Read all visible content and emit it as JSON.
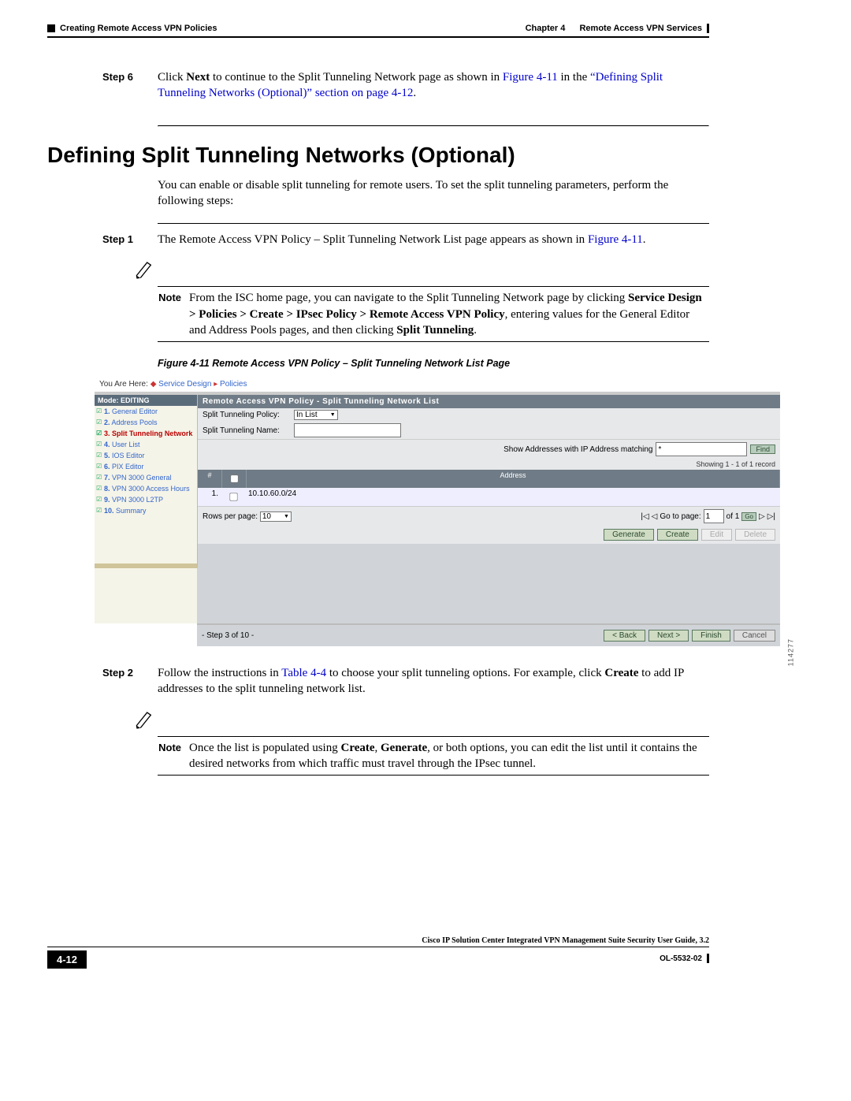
{
  "header": {
    "left": "Creating Remote Access VPN Policies",
    "right_chapter": "Chapter 4",
    "right_title": "Remote Access VPN Services"
  },
  "step6": {
    "label": "Step 6",
    "pre": "Click ",
    "next": "Next",
    "mid": " to continue to the Split Tunneling Network page as shown in ",
    "figref": "Figure 4-11",
    "mid2": " in the ",
    "linkq": "“Defining Split Tunneling Networks (Optional)” section on page 4-12",
    "post": "."
  },
  "section_title": "Defining Split Tunneling Networks (Optional)",
  "intro": "You can enable or disable split tunneling for remote users. To set the split tunneling parameters, perform the following steps:",
  "step1": {
    "label": "Step 1",
    "pre": "The Remote Access VPN Policy – Split Tunneling Network List page appears as shown in ",
    "figref": "Figure 4-11",
    "post": "."
  },
  "note1": {
    "label": "Note",
    "pre": "From the ISC home page, you can navigate to the Split Tunneling Network page by clicking ",
    "b1": "Service Design > Policies > Create > IPsec Policy > Remote Access VPN Policy",
    "mid": ", entering values for the General Editor and Address Pools pages, and then clicking ",
    "b2": "Split Tunneling",
    "post": "."
  },
  "figure_caption": "Figure 4-11   Remote Access VPN Policy – Split Tunneling Network List Page",
  "screenshot": {
    "breadcrumb_prefix": "You Are Here: ",
    "bc1": "Service Design",
    "bc2": "Policies",
    "mode": "Mode: EDITING",
    "sidebar": [
      {
        "n": "1.",
        "t": "General Editor",
        "cur": false
      },
      {
        "n": "2.",
        "t": "Address Pools",
        "cur": false
      },
      {
        "n": "3.",
        "t": "Split Tunneling Network",
        "cur": true
      },
      {
        "n": "4.",
        "t": "User List",
        "cur": false
      },
      {
        "n": "5.",
        "t": "IOS Editor",
        "cur": false
      },
      {
        "n": "6.",
        "t": "PIX Editor",
        "cur": false
      },
      {
        "n": "7.",
        "t": "VPN 3000 General",
        "cur": false
      },
      {
        "n": "8.",
        "t": "VPN 3000 Access Hours",
        "cur": false
      },
      {
        "n": "9.",
        "t": "VPN 3000 L2TP",
        "cur": false
      },
      {
        "n": "10.",
        "t": "Summary",
        "cur": false
      }
    ],
    "pane_title": "Remote Access VPN Policy - Split Tunneling Network List",
    "policy_label": "Split Tunneling Policy:",
    "policy_value": "In List",
    "name_label": "Split Tunneling Name:",
    "find_label": "Show Addresses with IP Address matching",
    "find_value": "*",
    "find_btn": "Find",
    "showing": "Showing 1 - 1 of 1 record",
    "col_num": "#",
    "col_addr": "Address",
    "row_num": "1.",
    "row_addr": "10.10.60.0/24",
    "rpp_label": "Rows per page:",
    "rpp_value": "10",
    "goto_label": "Go to page:",
    "goto_value": "1",
    "of_label": "of 1",
    "go_btn": "Go",
    "btn_generate": "Generate",
    "btn_create": "Create",
    "btn_edit": "Edit",
    "btn_delete": "Delete",
    "step_indicator": "- Step 3 of 10 -",
    "btn_back": "< Back",
    "btn_next": "Next >",
    "btn_finish": "Finish",
    "btn_cancel": "Cancel",
    "side_number": "114277"
  },
  "step2": {
    "label": "Step 2",
    "pre": "Follow the instructions in ",
    "tableref": "Table 4-4",
    "mid": " to choose your split tunneling options. For example, click ",
    "b": "Create",
    "post": " to add IP addresses to the split tunneling network list."
  },
  "note2": {
    "label": "Note",
    "pre": "Once the list is populated using ",
    "b1": "Create",
    "c1": ", ",
    "b2": "Generate",
    "post": ", or both options, you can edit the list until it contains the desired networks from which traffic must travel through the IPsec tunnel."
  },
  "footer": {
    "title": "Cisco IP Solution Center Integrated VPN Management Suite Security User Guide, 3.2",
    "page": "4-12",
    "doc": "OL-5532-02"
  }
}
